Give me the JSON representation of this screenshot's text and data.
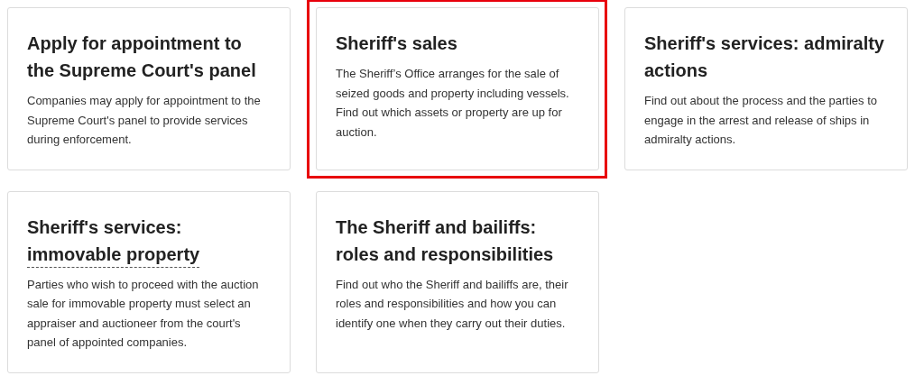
{
  "cards": [
    {
      "title": [
        {
          "text": "Apply for appointment to the Supreme Court's panel",
          "link": false
        }
      ],
      "description": "Companies may apply for appointment to the Supreme Court's panel to provide services during enforcement.",
      "highlighted": false
    },
    {
      "title": [
        {
          "text": "Sheriff's sales",
          "link": false
        }
      ],
      "description": "The Sheriff’s Office arranges for the sale of seized goods and property including vessels. Find out which assets or property are up for auction.",
      "highlighted": true
    },
    {
      "title": [
        {
          "text": "Sheriff's services: admiralty actions",
          "link": false
        }
      ],
      "description": "Find out about the process and the parties to engage in the arrest and release of ships in admiralty actions.",
      "highlighted": false
    },
    {
      "title": [
        {
          "text": "Sheriff's services:",
          "link": false
        },
        {
          "text": "immovable property",
          "link": true
        }
      ],
      "description": "Parties who wish to proceed with the auction sale for immovable property must select an appraiser and auctioneer from the court's panel of appointed companies.",
      "highlighted": false
    },
    {
      "title": [
        {
          "text": "The Sheriff and bailiffs: roles and responsibilities",
          "link": false
        }
      ],
      "description": "Find out who the Sheriff and bailiffs are, their roles and responsibilities and how you can identify one when they carry out their duties.",
      "highlighted": false
    }
  ]
}
